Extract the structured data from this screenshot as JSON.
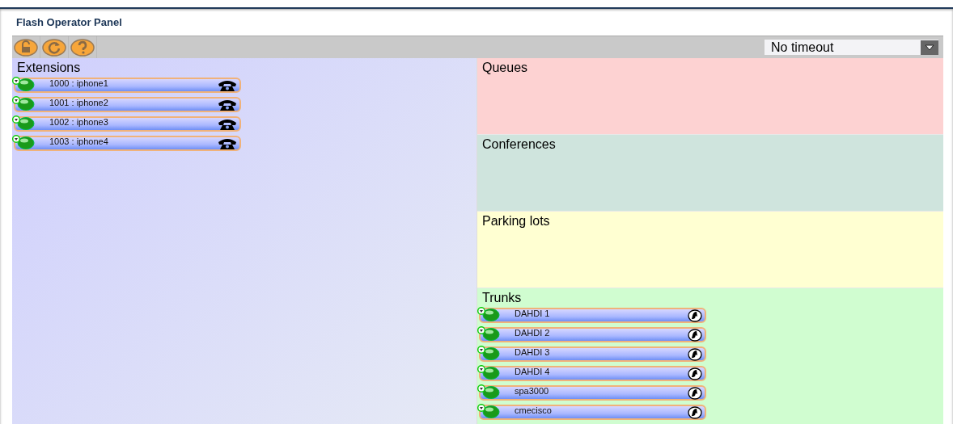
{
  "window": {
    "title": "Flash Operator Panel"
  },
  "toolbar": {
    "buttons": [
      {
        "kind": "lock"
      },
      {
        "kind": "reload"
      },
      {
        "kind": "help"
      }
    ],
    "timeout": {
      "value": "No timeout"
    }
  },
  "extensions": {
    "title": "Extensions",
    "items": [
      {
        "label": "1000 : iphone1",
        "kind": "phone"
      },
      {
        "label": "1001 : iphone2",
        "kind": "phone"
      },
      {
        "label": "1002 : iphone3",
        "kind": "phone"
      },
      {
        "label": "1003 : iphone4",
        "kind": "phone"
      }
    ]
  },
  "sections": [
    {
      "title": "Queues",
      "color": "#fdd2d2"
    },
    {
      "title": "Conferences",
      "color": "#cfe4dd"
    },
    {
      "title": "Parking lots",
      "color": "#ffffd2"
    },
    {
      "title": "Trunks",
      "color": "#d0fdd0",
      "items": [
        {
          "label": "DAHDI 1",
          "kind": "trunk"
        },
        {
          "label": "DAHDI 2",
          "kind": "trunk"
        },
        {
          "label": "DAHDI 3",
          "kind": "trunk"
        },
        {
          "label": "DAHDI 4",
          "kind": "trunk"
        },
        {
          "label": "spa3000",
          "kind": "trunk"
        },
        {
          "label": "cmecisco",
          "kind": "trunk"
        }
      ]
    }
  ]
}
